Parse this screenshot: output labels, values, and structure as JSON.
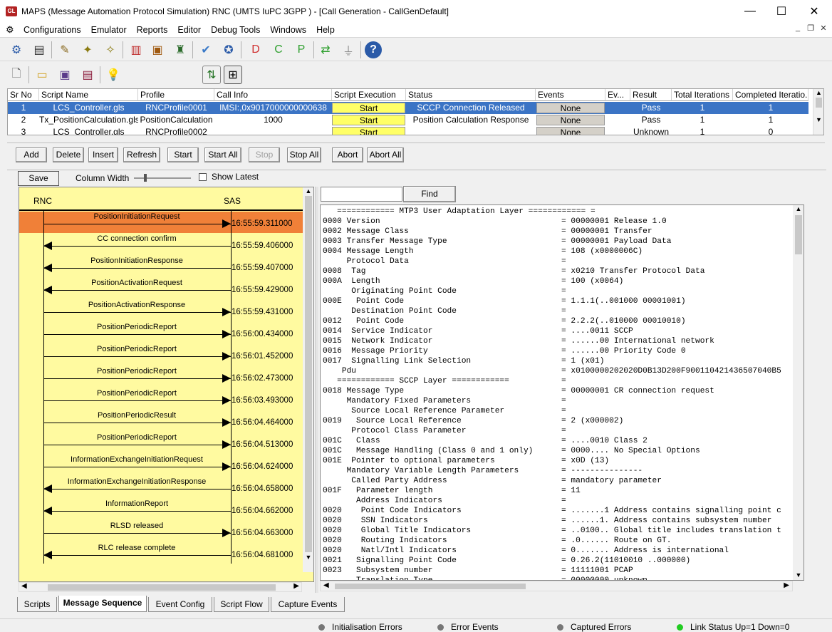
{
  "window": {
    "title": "MAPS (Message Automation Protocol Simulation) RNC (UMTS IuPC 3GPP ) - [Call Generation  - CallGenDefault]",
    "logo_text": "GL",
    "minimize": "—",
    "maximize": "☐",
    "close": "✕"
  },
  "menu": [
    "Configurations",
    "Emulator",
    "Reports",
    "Editor",
    "Debug Tools",
    "Windows",
    "Help"
  ],
  "grid": {
    "headers": [
      "Sr No",
      "Script Name",
      "Profile",
      "Call Info",
      "Script Execution",
      "Status",
      "Events",
      "Ev...",
      "Result",
      "Total Iterations",
      "Completed Iteratio..."
    ],
    "rows": [
      {
        "sr": "1",
        "script": "LCS_Controller.gls",
        "profile": "RNCProfile0001",
        "callinfo": "IMSI:,0x9017000000000638",
        "exec": "Start",
        "status": "SCCP Connection Released",
        "events": "None",
        "ev": "",
        "result": "Pass",
        "total": "1",
        "completed": "1"
      },
      {
        "sr": "2",
        "script": "Tx_PositionCalculation.gls",
        "profile": "PositionCalculation",
        "callinfo": "1000",
        "exec": "Start",
        "status": "Position Calculation Response",
        "events": "None",
        "ev": "",
        "result": "Pass",
        "total": "1",
        "completed": "1"
      },
      {
        "sr": "3",
        "script": "LCS_Controller.gls",
        "profile": "RNCProfile0002",
        "callinfo": "",
        "exec": "Start",
        "status": "",
        "events": "None",
        "ev": "",
        "result": "Unknown",
        "total": "1",
        "completed": "0"
      }
    ]
  },
  "buttons": {
    "add": "Add",
    "delete": "Delete",
    "insert": "Insert",
    "refresh": "Refresh",
    "start": "Start",
    "start_all": "Start All",
    "stop": "Stop",
    "stop_all": "Stop All",
    "abort": "Abort",
    "abort_all": "Abort All"
  },
  "seq": {
    "save": "Save",
    "column_width": "Column Width",
    "show_latest": "Show Latest",
    "left_node": "RNC",
    "right_node": "SAS",
    "messages": [
      {
        "label": "PositionInitiationRequest",
        "time": "16:55:59.311000",
        "dir": "right",
        "highlight": true
      },
      {
        "label": "CC connection confirm",
        "time": "16:55:59.406000",
        "dir": "left"
      },
      {
        "label": "PositionInitiationResponse",
        "time": "16:55:59.407000",
        "dir": "left"
      },
      {
        "label": "PositionActivationRequest",
        "time": "16:55:59.429000",
        "dir": "left"
      },
      {
        "label": "PositionActivationResponse",
        "time": "16:55:59.431000",
        "dir": "right"
      },
      {
        "label": "PositionPeriodicReport",
        "time": "16:56:00.434000",
        "dir": "right"
      },
      {
        "label": "PositionPeriodicReport",
        "time": "16:56:01.452000",
        "dir": "right"
      },
      {
        "label": "PositionPeriodicReport",
        "time": "16:56:02.473000",
        "dir": "right"
      },
      {
        "label": "PositionPeriodicReport",
        "time": "16:56:03.493000",
        "dir": "right"
      },
      {
        "label": "PositionPeriodicResult",
        "time": "16:56:04.464000",
        "dir": "right"
      },
      {
        "label": "PositionPeriodicReport",
        "time": "16:56:04.513000",
        "dir": "right"
      },
      {
        "label": "InformationExchangeInitiationRequest",
        "time": "16:56:04.624000",
        "dir": "right"
      },
      {
        "label": "InformationExchangeInitiationResponse",
        "time": "16:56:04.658000",
        "dir": "left"
      },
      {
        "label": "InformationReport",
        "time": "16:56:04.662000",
        "dir": "left"
      },
      {
        "label": "RLSD released",
        "time": "16:56:04.663000",
        "dir": "right"
      },
      {
        "label": "RLC release complete",
        "time": "16:56:04.681000",
        "dir": "left"
      }
    ]
  },
  "decode": {
    "find": "Find",
    "lines": [
      [
        "   ============ MTP3 User Adaptation Layer ============ =",
        ""
      ],
      [
        "0000 Version",
        "= 00000001 Release 1.0"
      ],
      [
        "0002 Message Class",
        "= 00000001 Transfer"
      ],
      [
        "0003 Transfer Message Type",
        "= 00000001 Payload Data"
      ],
      [
        "0004 Message Length",
        "= 108 (x0000006C)"
      ],
      [
        "     Protocol Data",
        "="
      ],
      [
        "0008  Tag",
        "= x0210 Transfer Protocol Data"
      ],
      [
        "000A  Length",
        "= 100 (x0064)"
      ],
      [
        "      Originating Point Code",
        "="
      ],
      [
        "000E   Point Code",
        "= 1.1.1(..001000 00001001)"
      ],
      [
        "      Destination Point Code",
        "="
      ],
      [
        "0012   Point Code",
        "= 2.2.2(..010000 00010010)"
      ],
      [
        "0014  Service Indicator",
        "= ....0011 SCCP"
      ],
      [
        "0015  Network Indicator",
        "= ......00 International network"
      ],
      [
        "0016  Message Priority",
        "= ......00 Priority Code 0"
      ],
      [
        "0017  Signalling Link Selection",
        "= 1 (x01)"
      ],
      [
        "    Pdu",
        "= x0100000202020D0B13D200F900110421436507040B5"
      ],
      [
        "   ============ SCCP Layer ============",
        "="
      ],
      [
        "0018 Message Type",
        "= 00000001 CR connection request"
      ],
      [
        "     Mandatory Fixed Parameters",
        "="
      ],
      [
        "      Source Local Reference Parameter",
        "="
      ],
      [
        "0019   Source Local Reference",
        "= 2 (x000002)"
      ],
      [
        "      Protocol Class Parameter",
        "="
      ],
      [
        "001C   Class",
        "= ....0010 Class 2"
      ],
      [
        "001C   Message Handling (Class 0 and 1 only)",
        "= 0000.... No Special Options"
      ],
      [
        "001E  Pointer to optional parameters",
        "= x0D (13)"
      ],
      [
        "     Mandatory Variable Length Parameters",
        "= ---------------"
      ],
      [
        "      Called Party Address",
        "= mandatory parameter"
      ],
      [
        "001F   Parameter length",
        "= 11"
      ],
      [
        "       Address Indicators",
        "="
      ],
      [
        "0020    Point Code Indicators",
        "= .......1 Address contains signalling point c"
      ],
      [
        "0020    SSN Indicators",
        "= ......1. Address contains subsystem number"
      ],
      [
        "0020    Global Title Indicators",
        "= ..0100.. Global title includes translation t"
      ],
      [
        "0020    Routing Indicators",
        "= .0...... Route on GT."
      ],
      [
        "0020    Natl/Intl Indicators",
        "= 0....... Address is international"
      ],
      [
        "0021   Signalling Point Code",
        "= 0.26.2(11010010 ..000000)"
      ],
      [
        "0023   Subsystem number",
        "= 11111001 PCAP"
      ],
      [
        "       Translation Type",
        "= 00000000 unknown"
      ]
    ]
  },
  "tabs": [
    "Scripts",
    "Message Sequence",
    "Event Config",
    "Script Flow",
    "Capture Events"
  ],
  "status": {
    "init_errors": "Initialisation Errors",
    "error_events": "Error Events",
    "captured_errors": "Captured Errors",
    "link_status": "Link Status Up=1 Down=0"
  },
  "colors": {
    "highlight_row": "#f08038",
    "seq_bg": "#fffaa0",
    "selected_row": "#3b74c5",
    "exec_button": "#ffff66",
    "link_up": "#22cc22"
  }
}
